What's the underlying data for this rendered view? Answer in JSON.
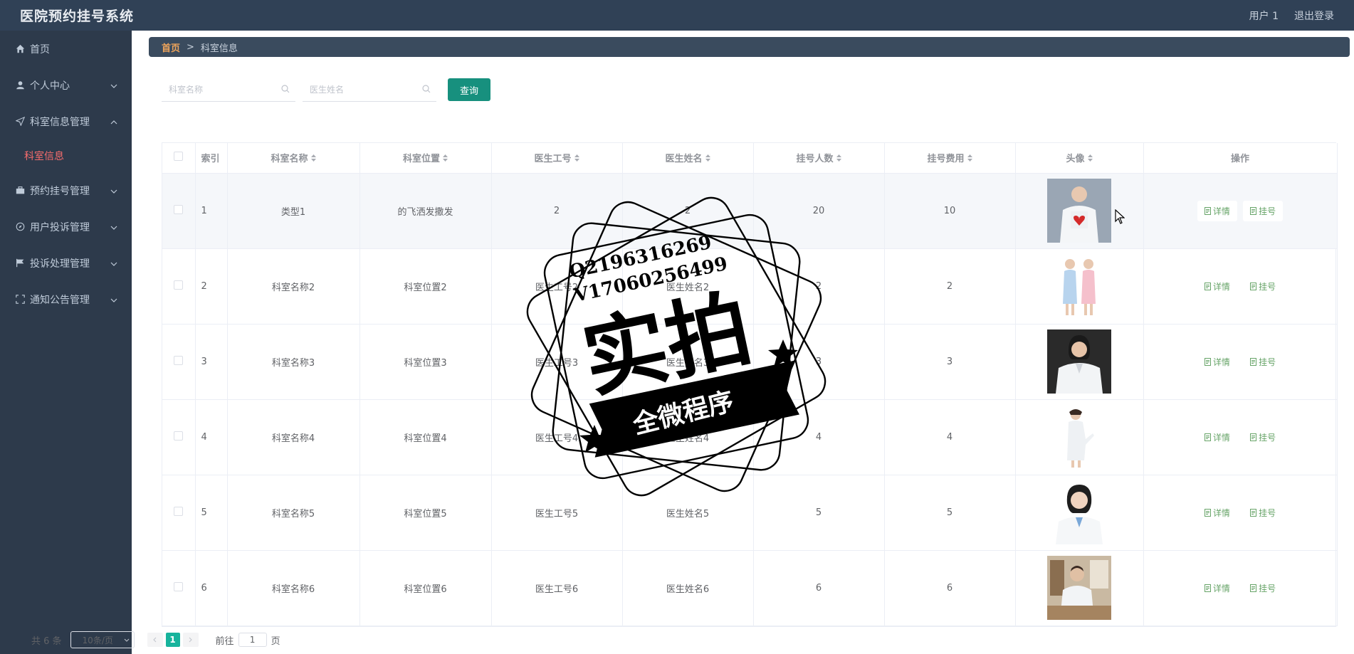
{
  "app": {
    "title": "医院预约挂号系统"
  },
  "header": {
    "user_label": "用户 1",
    "logout_label": "退出登录"
  },
  "sidebar": {
    "items": [
      {
        "label": "首页",
        "icon": "home-icon"
      },
      {
        "label": "个人中心",
        "icon": "user-icon"
      },
      {
        "label": "科室信息管理",
        "icon": "send-icon",
        "expanded": true,
        "sub": "科室信息"
      },
      {
        "label": "预约挂号管理",
        "icon": "briefcase-icon"
      },
      {
        "label": "用户投诉管理",
        "icon": "compass-icon"
      },
      {
        "label": "投诉处理管理",
        "icon": "flag-icon"
      },
      {
        "label": "通知公告管理",
        "icon": "fullscreen-icon"
      }
    ]
  },
  "breadcrumb": {
    "home": "首页",
    "sep": ">",
    "current": "科室信息"
  },
  "search": {
    "dept_placeholder": "科室名称",
    "doctor_placeholder": "医生姓名",
    "query_label": "查询"
  },
  "table": {
    "headers": [
      "索引",
      "科室名称",
      "科室位置",
      "医生工号",
      "医生姓名",
      "挂号人数",
      "挂号费用",
      "头像",
      "操作"
    ],
    "rows": [
      {
        "idx": "1",
        "dept": "类型1",
        "location": "的飞洒发撒发",
        "doc_id": "2",
        "doc_name": "2",
        "count": "20",
        "fee": "10"
      },
      {
        "idx": "2",
        "dept": "科室名称2",
        "location": "科室位置2",
        "doc_id": "医生工号2",
        "doc_name": "医生姓名2",
        "count": "2",
        "fee": "2"
      },
      {
        "idx": "3",
        "dept": "科室名称3",
        "location": "科室位置3",
        "doc_id": "医生工号3",
        "doc_name": "医生姓名3",
        "count": "3",
        "fee": "3"
      },
      {
        "idx": "4",
        "dept": "科室名称4",
        "location": "科室位置4",
        "doc_id": "医生工号4",
        "doc_name": "医生姓名4",
        "count": "4",
        "fee": "4"
      },
      {
        "idx": "5",
        "dept": "科室名称5",
        "location": "科室位置5",
        "doc_id": "医生工号5",
        "doc_name": "医生姓名5",
        "count": "5",
        "fee": "5"
      },
      {
        "idx": "6",
        "dept": "科室名称6",
        "location": "科室位置6",
        "doc_id": "医生工号6",
        "doc_name": "医生姓名6",
        "count": "6",
        "fee": "6"
      }
    ],
    "detail_label": "详情",
    "register_label": "挂号"
  },
  "pagination": {
    "total": "共 6 条",
    "page_size": "10条/页",
    "current_page": "1",
    "goto_label": "前往",
    "goto_value": "1",
    "page_unit": "页"
  },
  "watermark": {
    "line1": "Q2196316269",
    "line2": "V17060256499",
    "main": "实拍",
    "banner": "全微程序"
  },
  "colors": {
    "topbar": "#304156",
    "sidebar": "#2d3a4b",
    "accent": "#17907e",
    "active_sub": "#f56c6c",
    "breadcrumb_home": "#f0a55b",
    "op_link": "#67a468"
  }
}
